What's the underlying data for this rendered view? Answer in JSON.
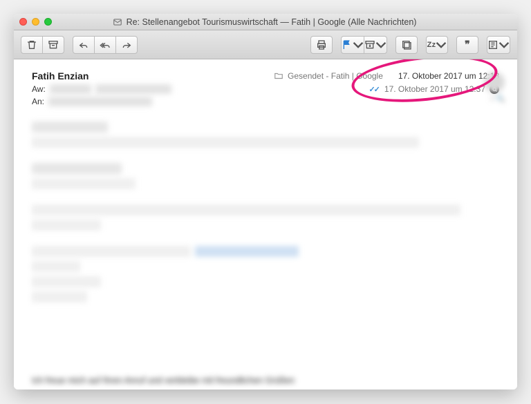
{
  "window": {
    "title": "Re: Stellenangebot Tourismuswirtschaft — Fatih | Google (Alle Nachrichten)"
  },
  "toolbar": {
    "zz_label": "Zz"
  },
  "header": {
    "sender": "Fatih Enzian",
    "mailbox": "Gesendet - Fatih | Google",
    "sent_timestamp": "17. Oktober 2017 um 12:18",
    "subject_prefix": "Aw:",
    "to_label": "An:",
    "read_receipt_timestamp": "17. Oktober 2017 um 12:37"
  },
  "body": {
    "closing_visible_fragment": "Ich freue mich auf Ihren Anruf und verbleibe mit freundlichen Grüßen"
  },
  "annotation": {
    "highlight_circle_present": true
  }
}
